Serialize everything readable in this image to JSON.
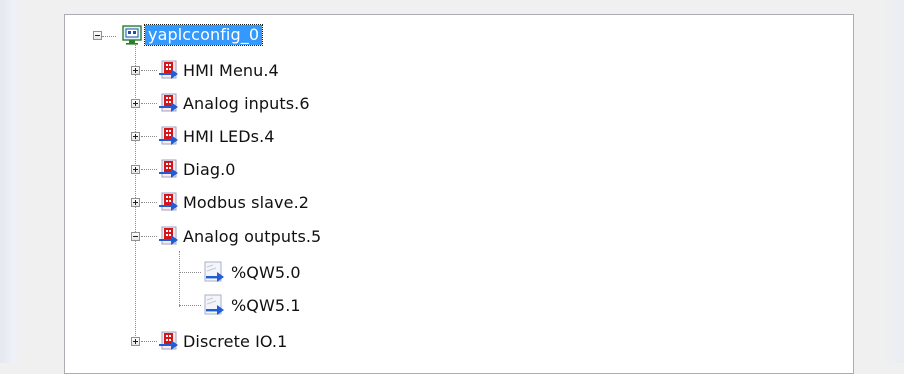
{
  "tree": {
    "root": {
      "label": "yaplcconfig_0",
      "icon": "config-icon",
      "expanded": true,
      "selected": true
    },
    "children": [
      {
        "label": "HMI Menu.4",
        "icon": "module-icon",
        "expanded": false
      },
      {
        "label": "Analog inputs.6",
        "icon": "module-icon",
        "expanded": false
      },
      {
        "label": "HMI LEDs.4",
        "icon": "module-icon",
        "expanded": false
      },
      {
        "label": "Diag.0",
        "icon": "module-icon",
        "expanded": false
      },
      {
        "label": "Modbus slave.2",
        "icon": "module-icon",
        "expanded": false
      },
      {
        "label": "Analog outputs.5",
        "icon": "module-icon",
        "expanded": true,
        "children": [
          {
            "label": "%QW5.0",
            "icon": "variable-icon"
          },
          {
            "label": "%QW5.1",
            "icon": "variable-icon"
          }
        ]
      },
      {
        "label": "Discrete IO.1",
        "icon": "module-icon",
        "expanded": false
      }
    ]
  },
  "colors": {
    "selection": "#3399ff",
    "tree_lines": "#8a8a8a",
    "panel_border": "#abadb3",
    "module_red": "#d4161b",
    "arrow_blue": "#1f5fd6"
  }
}
